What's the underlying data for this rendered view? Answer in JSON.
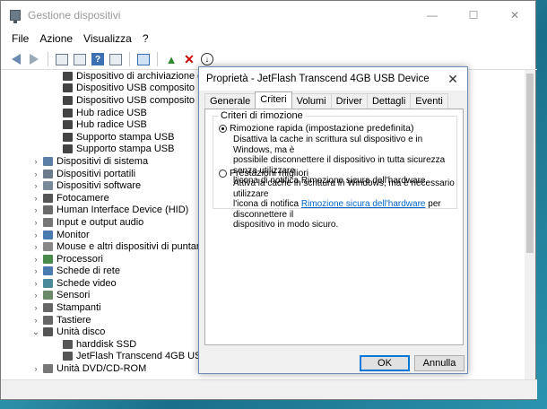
{
  "main_window": {
    "title": "Gestione dispositivi",
    "controls": {
      "minimize": "—",
      "maximize": "☐",
      "close": "✕"
    }
  },
  "menu": [
    "File",
    "Azione",
    "Visualizza",
    "?"
  ],
  "tree": [
    {
      "level": 2,
      "label": "Dispositivo di archiviazione di massa USB",
      "icon_color": "#444"
    },
    {
      "level": 2,
      "label": "Dispositivo USB composito",
      "icon_color": "#444"
    },
    {
      "level": 2,
      "label": "Dispositivo USB composito",
      "icon_color": "#444"
    },
    {
      "level": 2,
      "label": "Hub radice USB",
      "icon_color": "#444"
    },
    {
      "level": 2,
      "label": "Hub radice USB",
      "icon_color": "#444"
    },
    {
      "level": 2,
      "label": "Supporto stampa USB",
      "icon_color": "#444"
    },
    {
      "level": 2,
      "label": "Supporto stampa USB",
      "icon_color": "#444"
    },
    {
      "level": 1,
      "label": "Dispositivi di sistema",
      "icon_color": "#5b7fa6",
      "chev": "›"
    },
    {
      "level": 1,
      "label": "Dispositivi portatili",
      "icon_color": "#6b7b8b",
      "chev": "›"
    },
    {
      "level": 1,
      "label": "Dispositivi software",
      "icon_color": "#7a8a99",
      "chev": "›"
    },
    {
      "level": 1,
      "label": "Fotocamere",
      "icon_color": "#555",
      "chev": "›"
    },
    {
      "level": 1,
      "label": "Human Interface Device (HID)",
      "icon_color": "#6b6b6b",
      "chev": "›"
    },
    {
      "level": 1,
      "label": "Input e output audio",
      "icon_color": "#777",
      "chev": "›"
    },
    {
      "level": 1,
      "label": "Monitor",
      "icon_color": "#4a7bb0",
      "chev": "›"
    },
    {
      "level": 1,
      "label": "Mouse e altri dispositivi di puntamento",
      "icon_color": "#888",
      "chev": "›"
    },
    {
      "level": 1,
      "label": "Processori",
      "icon_color": "#4a8a4a",
      "chev": "›"
    },
    {
      "level": 1,
      "label": "Schede di rete",
      "icon_color": "#4a7bb0",
      "chev": "›"
    },
    {
      "level": 1,
      "label": "Schede video",
      "icon_color": "#4a8a9a",
      "chev": "›"
    },
    {
      "level": 1,
      "label": "Sensori",
      "icon_color": "#6a8a6a",
      "chev": "›"
    },
    {
      "level": 1,
      "label": "Stampanti",
      "icon_color": "#666",
      "chev": "›"
    },
    {
      "level": 1,
      "label": "Tastiere",
      "icon_color": "#666",
      "chev": "›"
    },
    {
      "level": 1,
      "label": "Unità disco",
      "icon_color": "#555",
      "chev": "⌄"
    },
    {
      "level": 2,
      "label": "harddisk SSD",
      "icon_color": "#555"
    },
    {
      "level": 2,
      "label": "JetFlash Transcend 4GB USB Device",
      "icon_color": "#555"
    },
    {
      "level": 1,
      "label": "Unità DVD/CD-ROM",
      "icon_color": "#777",
      "chev": "›"
    }
  ],
  "dialog": {
    "title": "Proprietà - JetFlash Transcend 4GB USB Device",
    "close": "✕",
    "tabs": [
      "Generale",
      "Criteri",
      "Volumi",
      "Driver",
      "Dettagli",
      "Eventi"
    ],
    "active_tab": "Criteri",
    "group_label": "Criteri di rimozione",
    "option1": {
      "label": "Rimozione rapida (impostazione predefinita)",
      "desc_lines": [
        "Disattiva la cache in scrittura sul dispositivo e in Windows, ma è",
        "possibile disconnettere il dispositivo in tutta sicurezza senza utilizzare",
        "l'icona di notifica Rimozione sicura dell'hardware."
      ],
      "checked": true
    },
    "option2": {
      "label": "Prestazioni migliori",
      "desc_line1": "Attiva la cache in scrittura in Windows, ma è necessario utilizzare",
      "desc_line2_pre": "l'icona di notifica ",
      "desc_line2_link": "Rimozione sicura dell'hardware",
      "desc_line2_post": " per disconnettere il",
      "desc_line3": "dispositivo in modo sicuro.",
      "checked": false
    },
    "ok_label": "OK",
    "cancel_label": "Annulla"
  }
}
